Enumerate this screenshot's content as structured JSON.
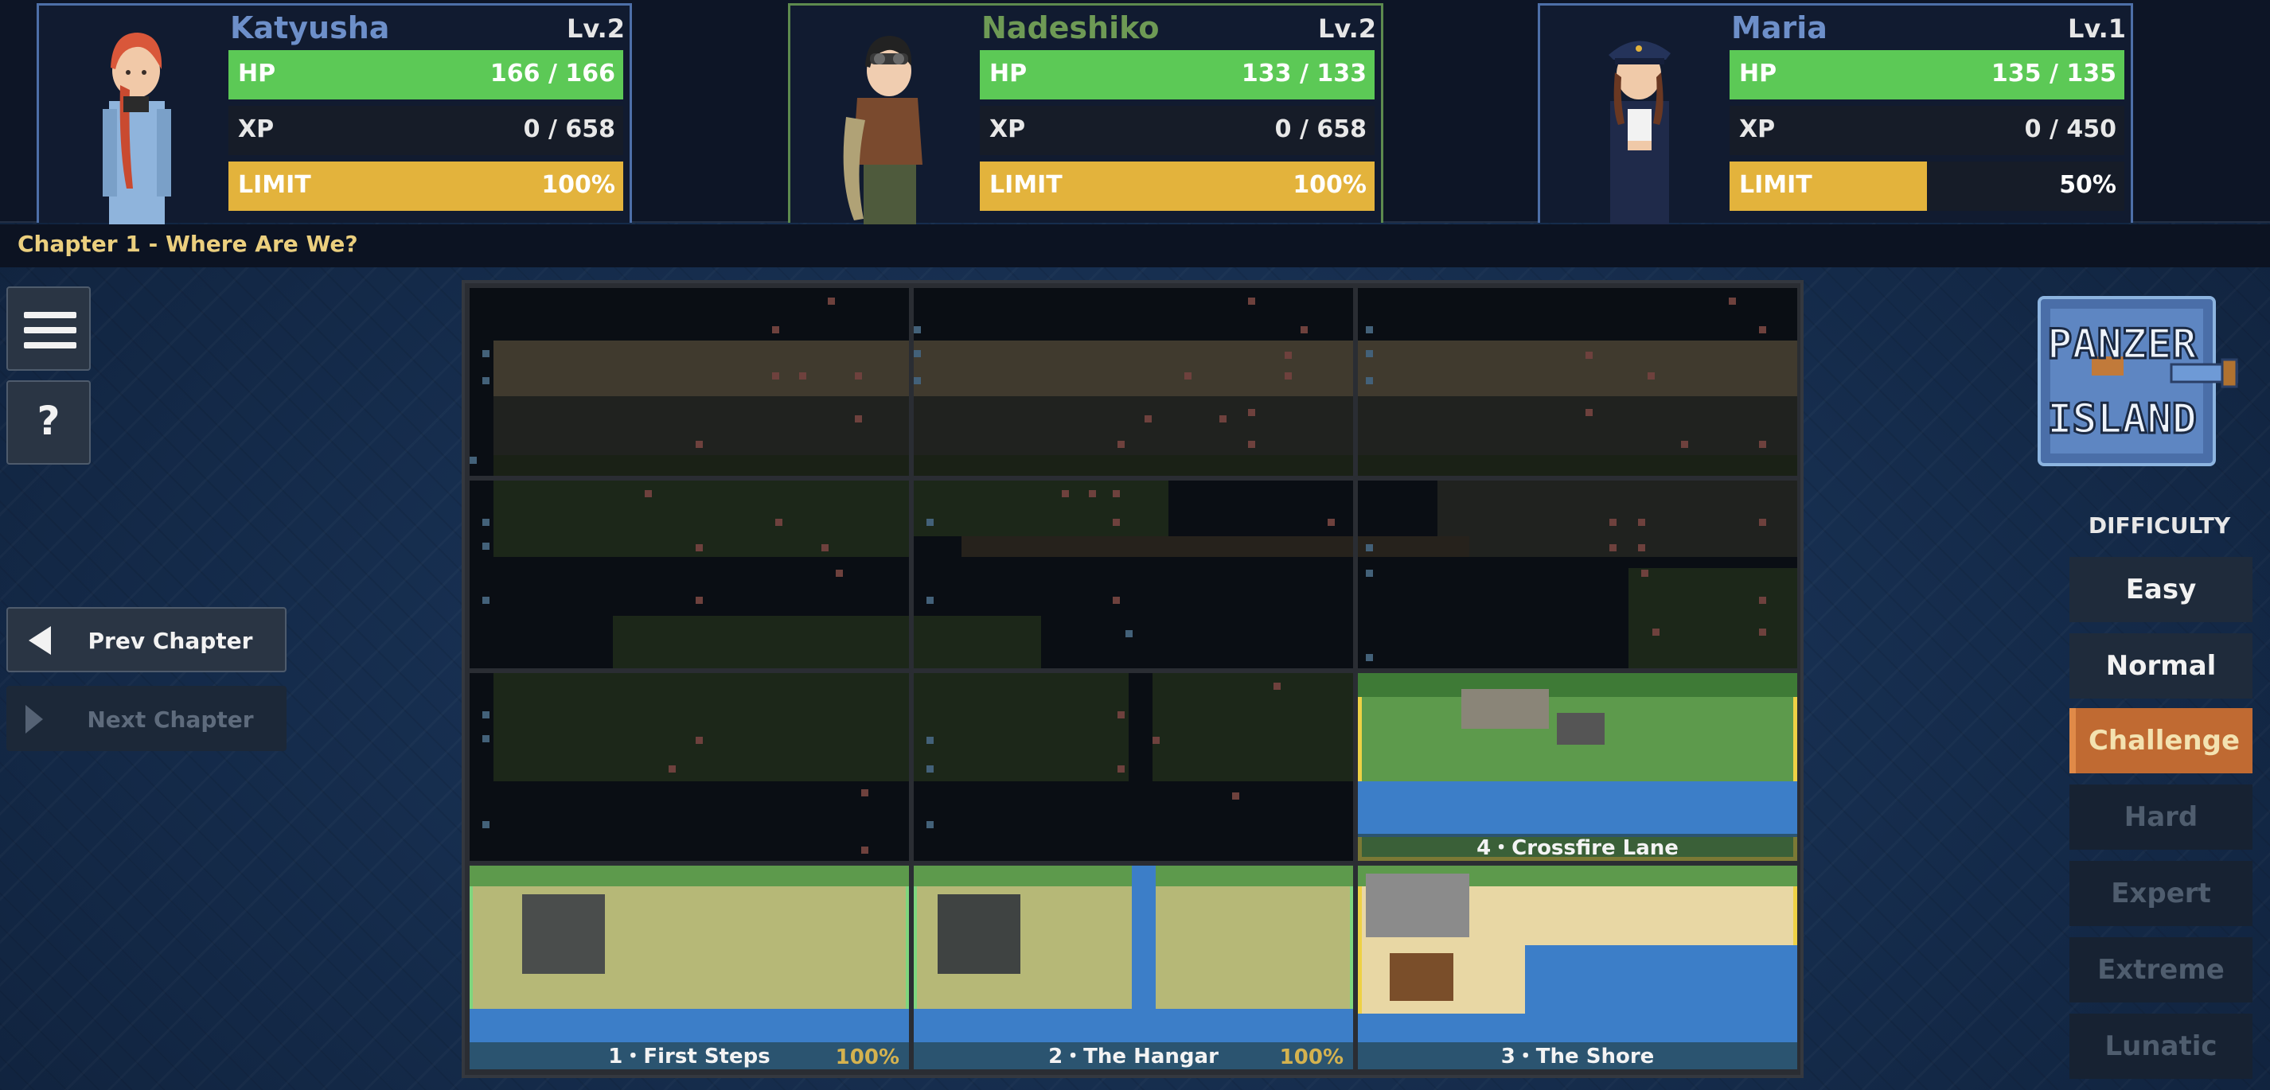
{
  "party": [
    {
      "name": "Katyusha",
      "level": "Lv.2",
      "hp_label": "HP",
      "hp": "166 / 166",
      "hp_fill": 1.0,
      "xp_label": "XP",
      "xp": "0 / 658",
      "limit_label": "LIMIT",
      "limit": "100%",
      "limit_fill": 1.0,
      "frame": "blue"
    },
    {
      "name": "Nadeshiko",
      "level": "Lv.2",
      "hp_label": "HP",
      "hp": "133 / 133",
      "hp_fill": 1.0,
      "xp_label": "XP",
      "xp": "0 / 658",
      "limit_label": "LIMIT",
      "limit": "100%",
      "limit_fill": 1.0,
      "frame": "green"
    },
    {
      "name": "Maria",
      "level": "Lv.1",
      "hp_label": "HP",
      "hp": "135 / 135",
      "hp_fill": 1.0,
      "xp_label": "XP",
      "xp": "0 / 450",
      "limit_label": "LIMIT",
      "limit": "50%",
      "limit_fill": 0.5,
      "frame": "blue"
    }
  ],
  "chapter": {
    "title": "Chapter 1  -  Where Are We?"
  },
  "nav": {
    "menu_icon": "hamburger-menu-icon",
    "help_label": "?",
    "prev_chapter": "Prev Chapter",
    "next_chapter": "Next Chapter"
  },
  "stages": [
    {
      "id": "1",
      "name": "1・First Steps",
      "completion": "100%",
      "state": "cleared"
    },
    {
      "id": "2",
      "name": "2・The Hangar",
      "completion": "100%",
      "state": "cleared"
    },
    {
      "id": "3",
      "name": "3・The Shore",
      "completion": "",
      "state": "selected"
    },
    {
      "id": "4",
      "name": "4・Crossfire Lane",
      "completion": "",
      "state": "selected"
    }
  ],
  "logo": {
    "line1": "PANZER",
    "line2": "ISLAND"
  },
  "difficulty": {
    "title": "DIFFICULTY",
    "options": [
      {
        "label": "Easy",
        "state": "available"
      },
      {
        "label": "Normal",
        "state": "available"
      },
      {
        "label": "Challenge",
        "state": "active"
      },
      {
        "label": "Hard",
        "state": "locked"
      },
      {
        "label": "Expert",
        "state": "locked"
      },
      {
        "label": "Extreme",
        "state": "locked"
      },
      {
        "label": "Lunatic",
        "state": "locked"
      }
    ]
  },
  "colors": {
    "hp": "#5cc956",
    "limit": "#e3b33c",
    "selected_outline": "#eed145",
    "cleared_outline": "#7fd67e",
    "active_difficulty": "#c06a32",
    "chapter_title": "#ebcf7e"
  }
}
